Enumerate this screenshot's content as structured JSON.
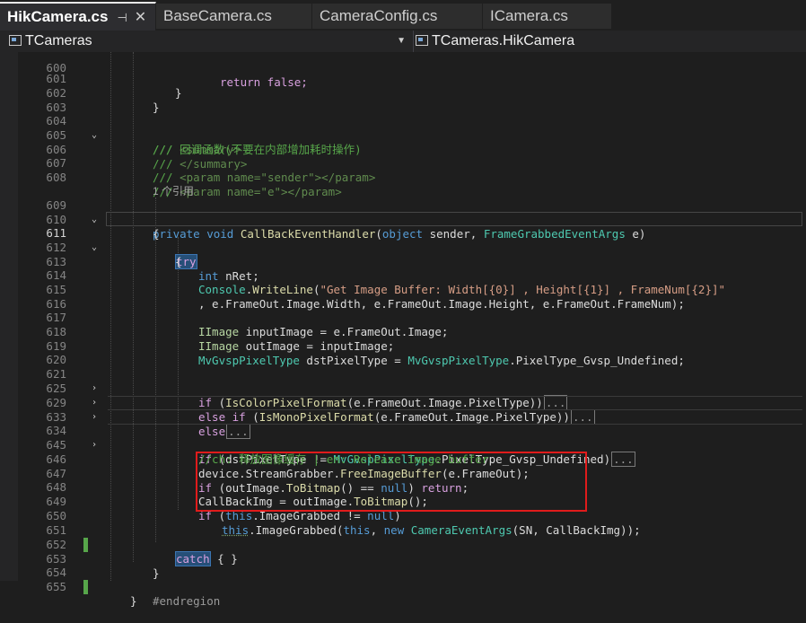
{
  "tabs": [
    {
      "label": "HikCamera.cs",
      "active": true,
      "pin_icon": "pin-icon",
      "close_icon": "close-icon"
    },
    {
      "label": "BaseCamera.cs",
      "active": false
    },
    {
      "label": "CameraConfig.cs",
      "active": false
    },
    {
      "label": "ICamera.cs",
      "active": false
    }
  ],
  "nav": {
    "left": "TCameras",
    "right": "TCameras.HikCamera"
  },
  "line_numbers": [
    "600",
    "601",
    "602",
    "603",
    "604",
    "605",
    "606",
    "607",
    "608",
    "609",
    "610",
    "611",
    "612",
    "613",
    "614",
    "615",
    "616",
    "617",
    "618",
    "619",
    "620",
    "621",
    "625",
    "629",
    "633",
    "634",
    "645",
    "646",
    "647",
    "648",
    "649",
    "650",
    "651",
    "652",
    "653",
    "654",
    "655"
  ],
  "code": {
    "l600": "return false;",
    "l601": "}",
    "l602": "}",
    "l604a": "/// ",
    "l604b": "<summary>",
    "l605": "/// 回调函数(不要在内部增加耗时操作)",
    "l606a": "/// ",
    "l606b": "</summary>",
    "l607a": "/// ",
    "l607b": "<param name=\"sender\"></param>",
    "l608a": "/// ",
    "l608b": "<param name=\"e\"></param>",
    "refs": "1 个引用",
    "l609_private": "private",
    "l609_void": "void",
    "l609_name": "CallBackEventHandler",
    "l609_object": "object",
    "l609_sender": "sender, ",
    "l609_args": "FrameGrabbedEventArgs",
    "l609_e": " e)",
    "l610": "{",
    "l611": "try",
    "l612": "{",
    "l613_int": "int",
    "l613_rest": " nRet;",
    "l614_console": "Console",
    "l614_write": "WriteLine",
    "l614_str": "\"Get Image Buffer: Width[{0}] , Height[{1}] , FrameNum[{2}]\"",
    "l615": ", e.FrameOut.Image.Width, e.FrameOut.Image.Height, e.FrameOut.FrameNum);",
    "l617_type": "IImage",
    "l617_rest": " inputImage = e.FrameOut.Image;",
    "l618_type": "IImage",
    "l618_rest": " outImage = inputImage;",
    "l619_type": "MvGvspPixelType",
    "l619_mid": " dstPixelType = ",
    "l619_type2": "MvGvspPixelType",
    "l619_rest": ".PixelType_Gvsp_Undefined;",
    "l621_if": "if",
    "l621_m": "IsColorPixelFormat",
    "l621_rest": "(e.FrameOut.Image.PixelType))",
    "l625_else": "else",
    "l625_if": "if",
    "l625_m": "IsMonoPixelFormat",
    "l625_rest": "(e.FrameOut.Image.PixelType))",
    "l629_else": "else",
    "collapsed": "...",
    "l634_if": "if",
    "l634_mid": " (dstPixelType != ",
    "l634_type": "MvGvspPixelType",
    "l634_rest": ".PixelType_Gvsp_Undefined)",
    "l645": "//ch: 释放图像缓存 | en: Release image buffer",
    "l646_a": "device.StreamGrabber.",
    "l646_m": "FreeImageBuffer",
    "l646_rest": "(e.FrameOut);",
    "l647_if": "if",
    "l647_a": " (outImage.",
    "l647_m": "ToBitmap",
    "l647_b": "() == ",
    "l647_null": "null",
    "l647_c": ") ",
    "l647_ret": "return",
    "l648_a": "CallBackImg = outImage.",
    "l648_m": "ToBitmap",
    "l648_b": "();",
    "l649_if": "if",
    "l649_a": " (",
    "l649_this": "this",
    "l649_b": ".ImageGrabbed != ",
    "l649_null": "null",
    "l649_c": ")",
    "l650_this": "this",
    "l650_a": ".ImageGrabbed(",
    "l650_this2": "this",
    "l650_b": ", ",
    "l650_new": "new",
    "l650_type": "CameraEventArgs",
    "l650_c": "(SN, CallBackImg));",
    "l651": "}",
    "l652_catch": "catch",
    "l652_rest": " { }",
    "l653": "}",
    "l654": "#endregion",
    "l655": "}"
  },
  "colors": {
    "keyword": "#569cd6",
    "control": "#d8a0df",
    "type": "#4ec9b0",
    "method": "#dcdcaa",
    "string": "#d69d85",
    "comment": "#57a64a",
    "highlight_box": "#e01b1b",
    "change_marker": "#57a64a"
  }
}
